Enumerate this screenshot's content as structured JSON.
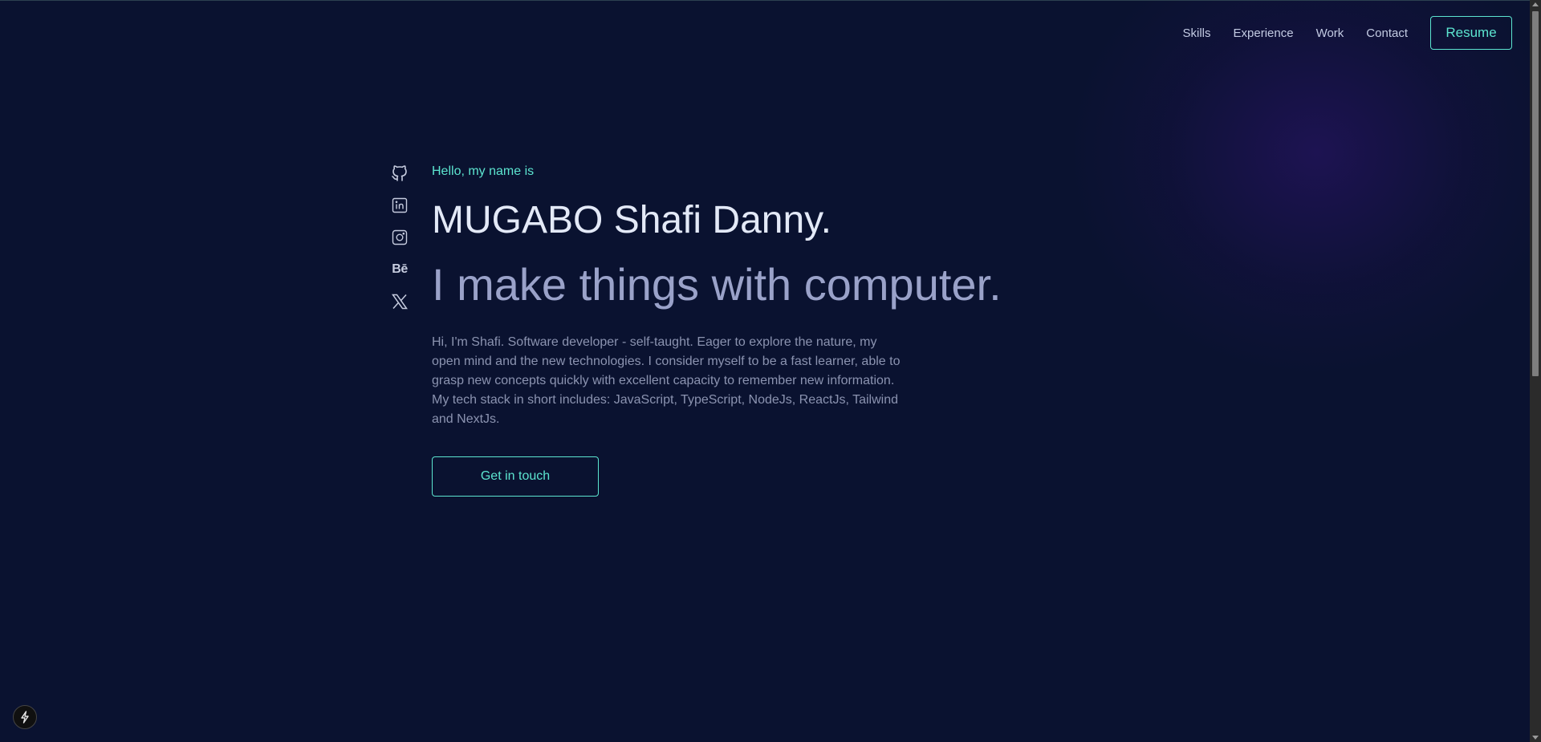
{
  "nav": {
    "links": [
      "Skills",
      "Experience",
      "Work",
      "Contact"
    ],
    "resume_label": "Resume"
  },
  "socials": [
    "github-icon",
    "linkedin-icon",
    "instagram-icon",
    "behance-icon",
    "x-icon"
  ],
  "behance_text": "Bē",
  "hero": {
    "greeting": "Hello, my name is",
    "name": "MUGABO Shafi Danny.",
    "tagline": "I make things with computer.",
    "bio": "Hi, I'm Shafi. Software developer - self-taught. Eager to explore the nature, my open mind and the new technologies. I consider myself to be a fast learner, able to grasp new concepts quickly with excellent capacity to remember new information. My tech stack in short includes: JavaScript, TypeScript, NodeJs, ReactJs, Tailwind and NextJs.",
    "cta_label": "Get in touch"
  },
  "colors": {
    "background": "#0a1230",
    "accent": "#5ce5d0",
    "heading": "#e3e9f7",
    "subheading": "#9aa2c9",
    "body_text": "#8b93b0"
  }
}
